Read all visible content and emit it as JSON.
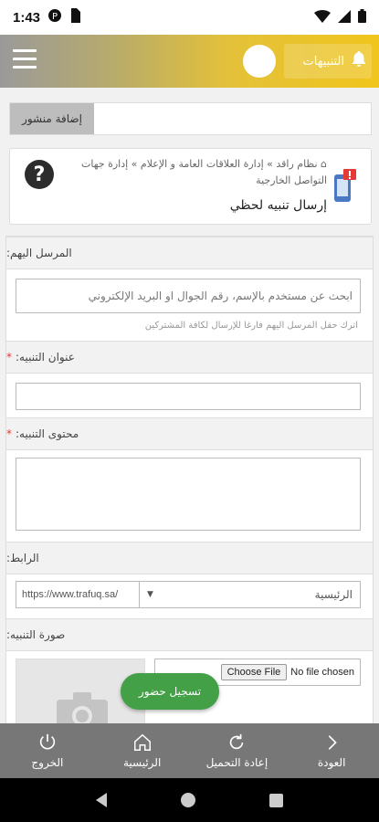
{
  "status_bar": {
    "time": "1:43"
  },
  "header": {
    "notifications_label": "التنبيهات"
  },
  "toolbar": {
    "add_post_label": "إضافة منشور"
  },
  "breadcrumb": {
    "text": "نظام راقد » إدارة العلاقات العامة و الإعلام » إدارة جهات التواصل الخارجية",
    "page_title": "إرسال تنبيه لحظي"
  },
  "form": {
    "recipients": {
      "label": "المرسل اليهم:",
      "placeholder": "ابحث عن مستخدم بالإسم، رقم الجوال او البريد الإلكتروني",
      "hint": "اترك حقل المرسل اليهم فارغا للإرسال لكافة المشتركين"
    },
    "title": {
      "label": "عنوان التنبيه:",
      "required_mark": "*"
    },
    "content": {
      "label": "محتوى التنبيه:",
      "required_mark": "*"
    },
    "link": {
      "label": "الرابط:",
      "select_value": "الرئيسية",
      "url_value": "https://www.trafuq.sa/"
    },
    "image": {
      "label": "صورة التنبيه:",
      "choose_file_label": "Choose File",
      "no_file_label": "No file chosen"
    }
  },
  "fab": {
    "label": "تسجيل حضور"
  },
  "bottom_nav": {
    "items": [
      {
        "label": "الخروج",
        "icon": "power-icon"
      },
      {
        "label": "الرئيسية",
        "icon": "home-icon"
      },
      {
        "label": "إعادة التحميل",
        "icon": "reload-icon"
      },
      {
        "label": "العودة",
        "icon": "chevron-right-icon"
      }
    ]
  },
  "colors": {
    "accent": "#f0c51d",
    "fab": "#43a047",
    "nav_bg": "#777777"
  }
}
